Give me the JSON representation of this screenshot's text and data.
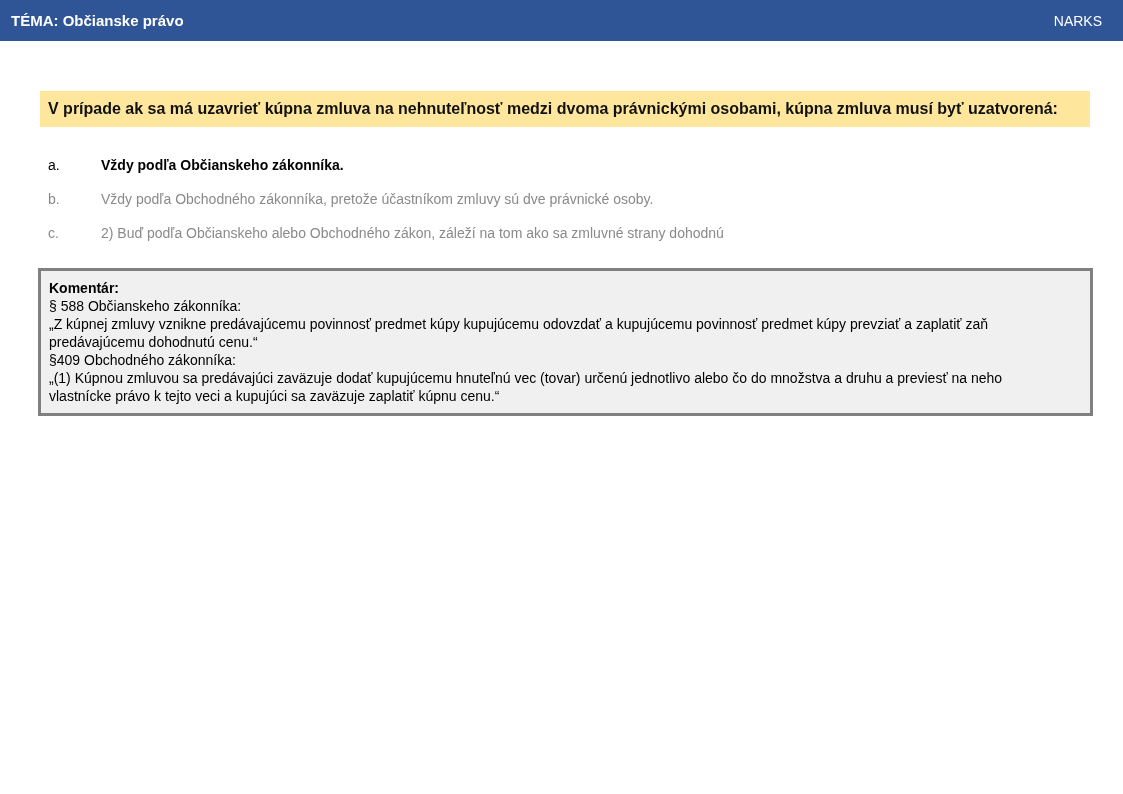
{
  "header": {
    "title": "TÉMA: Občianske právo",
    "brand": "NARKS"
  },
  "question": "V prípade ak sa má uzavrieť kúpna zmluva na nehnuteľnosť medzi dvoma právnickými osobami, kúpna zmluva musí byť uzatvorená:",
  "options": [
    {
      "letter": "a.",
      "text": "Vždy podľa Občianskeho zákonníka.",
      "selected": true
    },
    {
      "letter": "b.",
      "text": "Vždy podľa Obchodného zákonníka, pretože účastníkom zmluvy sú dve právnické osoby.",
      "selected": false
    },
    {
      "letter": "c.",
      "text": "2) Buď podľa Občianskeho alebo Obchodného zákon, záleží na tom ako sa zmluvné strany dohodnú",
      "selected": false
    }
  ],
  "comment": {
    "title": "Komentár:",
    "lines": [
      "§ 588 Občianskeho zákonníka:",
      "„Z kúpnej zmluvy vznikne predávajúcemu povinnosť predmet kúpy kupujúcemu odovzdať a kupujúcemu povinnosť predmet kúpy prevziať a zaplatiť zaň predávajúcemu dohodnutú cenu.“",
      "§409 Obchodného zákonníka:",
      "„(1) Kúpnou zmluvou sa predávajúci zaväzuje dodať kupujúcemu hnuteľnú vec (tovar) určenú jednotlivo alebo čo do množstva a druhu a previesť na neho vlastnícke právo k tejto veci a kupujúci sa zaväzuje zaplatiť kúpnu cenu.“"
    ]
  }
}
